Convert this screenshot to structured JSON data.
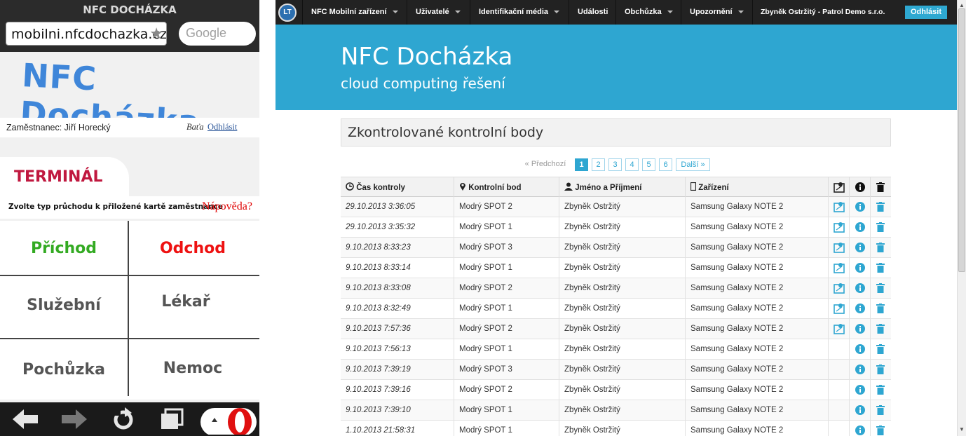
{
  "mobile": {
    "title": "NFC DOCHÁZKA",
    "url": "mobilni.nfcdochazka.cz",
    "search_placeholder": "Google",
    "logo_text": "NFC Docházka",
    "employee": "Zaměstnanec: Jiří Horecký",
    "company": "Baťa",
    "logout": "Odhlásit",
    "tab": "TERMINÁL",
    "instruction": "Zvolte typ průchodu k přiložené kartě zaměstnance",
    "help": "Nápověda?",
    "buttons": [
      {
        "label": "Příchod",
        "color": "#33aa22"
      },
      {
        "label": "Odchod",
        "color": "#ee1111"
      },
      {
        "label": "Služební",
        "color": "#555555"
      },
      {
        "label": "Lékař",
        "color": "#555555"
      },
      {
        "label": "Pochůzka",
        "color": "#555555"
      },
      {
        "label": "Nemoc",
        "color": "#555555"
      }
    ],
    "bottom_icons": [
      "back-arrow-icon",
      "forward-arrow-icon",
      "reload-icon",
      "tabs-icon",
      "opera-icon"
    ]
  },
  "desktop": {
    "nav": {
      "logo": "LT",
      "items": [
        {
          "label": "NFC Mobilní zařízení",
          "dropdown": true
        },
        {
          "label": "Uživatelé",
          "dropdown": true
        },
        {
          "label": "Identifikační média",
          "dropdown": true
        },
        {
          "label": "Události",
          "dropdown": false
        },
        {
          "label": "Obchůzka",
          "dropdown": true
        },
        {
          "label": "Upozornění",
          "dropdown": true
        }
      ],
      "user": "Zbyněk Ostržitý - Patrol Demo s.r.o.",
      "logout": "Odhlásit"
    },
    "hero": {
      "title": "NFC Docházka",
      "subtitle": "cloud computing řešení"
    },
    "section_title": "Zkontrolované kontrolní body",
    "pagination": {
      "prev": "« Předchozí",
      "pages": [
        "1",
        "2",
        "3",
        "4",
        "5",
        "6"
      ],
      "active": "1",
      "next": "Další »"
    },
    "table": {
      "columns": [
        "Čas kontroly",
        "Kontrolní bod",
        "Jméno a Příjmení",
        "Zařízení"
      ],
      "column_icons": [
        "clock-icon",
        "map-marker-icon",
        "user-icon",
        "phone-icon",
        "map-icon",
        "info-icon",
        "trash-icon"
      ],
      "rows": [
        {
          "time": "29.10.2013 3:36:05",
          "point": "Modrý SPOT 2",
          "name": "Zbyněk Ostržitý",
          "device": "Samsung Galaxy NOTE 2",
          "map": true
        },
        {
          "time": "29.10.2013 3:35:32",
          "point": "Modrý SPOT 1",
          "name": "Zbyněk Ostržitý",
          "device": "Samsung Galaxy NOTE 2",
          "map": true
        },
        {
          "time": "9.10.2013 8:33:23",
          "point": "Modrý SPOT 3",
          "name": "Zbyněk Ostržitý",
          "device": "Samsung Galaxy NOTE 2",
          "map": true
        },
        {
          "time": "9.10.2013 8:33:14",
          "point": "Modrý SPOT 1",
          "name": "Zbyněk Ostržitý",
          "device": "Samsung Galaxy NOTE 2",
          "map": true
        },
        {
          "time": "9.10.2013 8:33:08",
          "point": "Modrý SPOT 2",
          "name": "Zbyněk Ostržitý",
          "device": "Samsung Galaxy NOTE 2",
          "map": true
        },
        {
          "time": "9.10.2013 8:32:49",
          "point": "Modrý SPOT 1",
          "name": "Zbyněk Ostržitý",
          "device": "Samsung Galaxy NOTE 2",
          "map": true
        },
        {
          "time": "9.10.2013 7:57:36",
          "point": "Modrý SPOT 2",
          "name": "Zbyněk Ostržitý",
          "device": "Samsung Galaxy NOTE 2",
          "map": true
        },
        {
          "time": "9.10.2013 7:56:13",
          "point": "Modrý SPOT 1",
          "name": "Zbyněk Ostržitý",
          "device": "Samsung Galaxy NOTE 2",
          "map": false
        },
        {
          "time": "9.10.2013 7:39:19",
          "point": "Modrý SPOT 3",
          "name": "Zbyněk Ostržitý",
          "device": "Samsung Galaxy NOTE 2",
          "map": false
        },
        {
          "time": "9.10.2013 7:39:16",
          "point": "Modrý SPOT 2",
          "name": "Zbyněk Ostržitý",
          "device": "Samsung Galaxy NOTE 2",
          "map": false
        },
        {
          "time": "9.10.2013 7:39:10",
          "point": "Modrý SPOT 1",
          "name": "Zbyněk Ostržitý",
          "device": "Samsung Galaxy NOTE 2",
          "map": false
        },
        {
          "time": "1.10.2013 21:58:31",
          "point": "Modrý SPOT 1",
          "name": "Zbyněk Ostržitý",
          "device": "Samsung Galaxy NOTE 2",
          "map": false
        }
      ]
    },
    "accent_color": "#2ea6d1"
  }
}
